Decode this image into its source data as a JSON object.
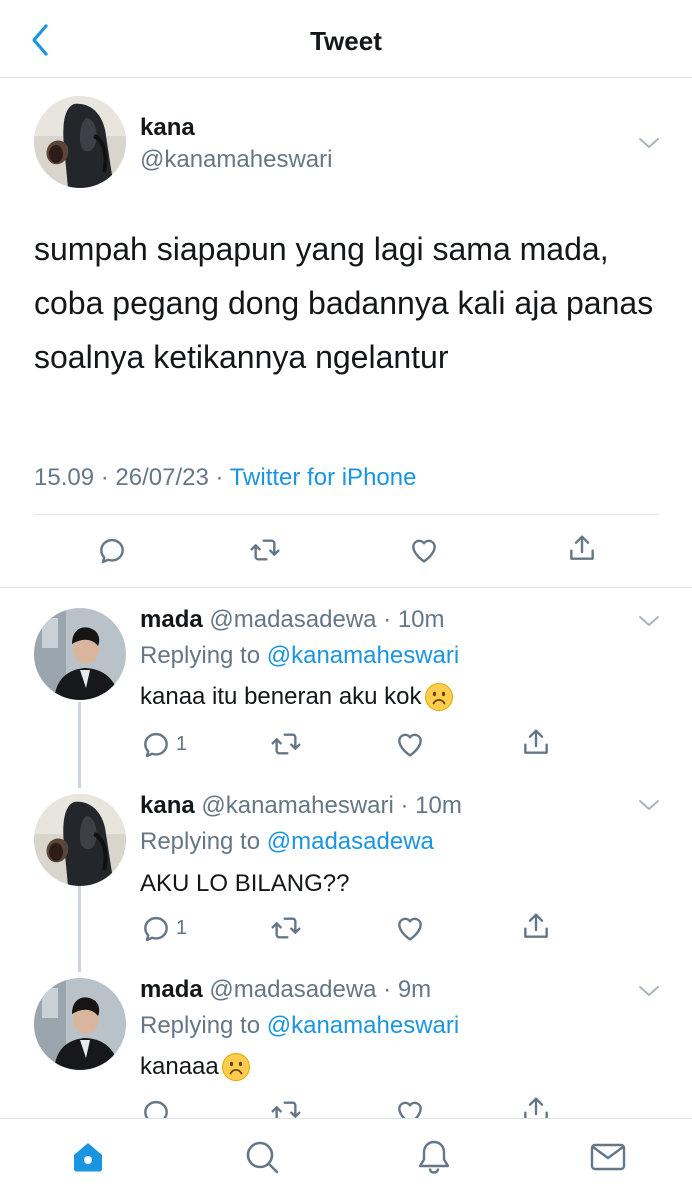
{
  "header": {
    "title": "Tweet",
    "back_icon": "chevron-left-icon"
  },
  "main_tweet": {
    "name": "kana",
    "handle": "@kanamaheswari",
    "text": "sumpah siapapun yang lagi sama mada, coba pegang dong badannya kali aja panas soalnya ketikannya ngelantur",
    "time": "15.09 · 26/07/23 · ",
    "source": "Twitter for iPhone"
  },
  "replies": [
    {
      "name": "mada",
      "meta": "@madasadewa · 10m",
      "replying_label": "Replying to ",
      "replying_handle": "@kanamaheswari",
      "text": "kanaa itu beneran aku kok",
      "reply_count": "1"
    },
    {
      "name": "kana",
      "meta": "@kanamaheswari · 10m",
      "replying_label": "Replying to ",
      "replying_handle": "@madasadewa",
      "text": "AKU LO BILANG??",
      "reply_count": "1"
    },
    {
      "name": "mada",
      "meta": "@madasadewa · 9m",
      "replying_label": "Replying to ",
      "replying_handle": "@kanamaheswari",
      "text": "kanaaa",
      "reply_count": ""
    }
  ],
  "tabbar": [
    "home-icon",
    "search-icon",
    "notifications-icon",
    "messages-icon"
  ],
  "colors": {
    "accent": "#1b95e0",
    "secondary_text": "#657786",
    "divider": "#dfe3e6",
    "icon": "#657786"
  }
}
